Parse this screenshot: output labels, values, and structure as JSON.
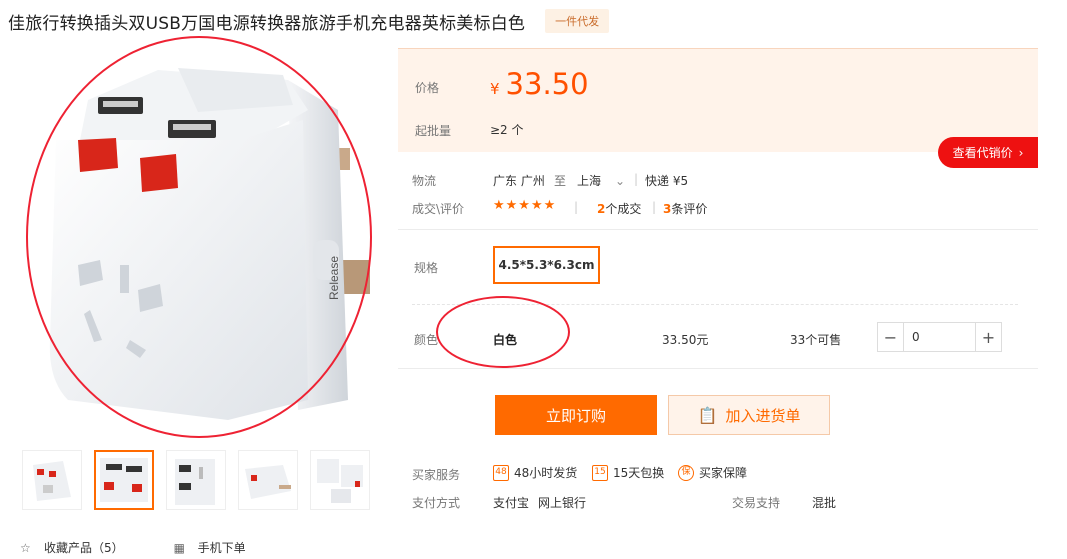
{
  "header": {
    "title": "佳旅行转换插头双USB万国电源转换器旅游手机充电器英标美标白色",
    "badge": "一件代发"
  },
  "price": {
    "label": "价格",
    "currency": "¥",
    "value": "33.50",
    "min_label": "起批量",
    "min_value": "≥2 个"
  },
  "agent_button": "查看代销价",
  "logistics": {
    "label": "物流",
    "from": "广东 广州",
    "to_word": "至",
    "to": "上海",
    "shipping": "快递 ¥5"
  },
  "reviews": {
    "label": "成交\\评价",
    "stars": "★★★★★",
    "deals_count": "2",
    "deals_text": "个成交",
    "review_count": "3",
    "review_text": "条评价"
  },
  "spec": {
    "label": "规格",
    "value": "4.5*5.3*6.3cm"
  },
  "color_row": {
    "label": "颜色",
    "value": "白色",
    "price": "33.50元",
    "stock": "33个可售",
    "quantity": "0",
    "minus": "−",
    "plus": "+"
  },
  "actions": {
    "order": "立即订购",
    "cart": "加入进货单"
  },
  "service": {
    "label": "买家服务",
    "items": [
      {
        "icon": "48",
        "text": "48小时发货"
      },
      {
        "icon": "15",
        "text": "15天包换"
      },
      {
        "icon": "保",
        "text": "买家保障"
      }
    ]
  },
  "payment": {
    "label": "支付方式",
    "methods": [
      "支付宝",
      "网上银行"
    ],
    "trade_label": "交易支持",
    "trade_value": "混批"
  },
  "bottom": {
    "favorite": "收藏产品（5）",
    "mobile": "手机下单"
  },
  "colors": {
    "accent": "#ff6a00",
    "price": "#ff5000",
    "annotation": "#ee2233"
  }
}
